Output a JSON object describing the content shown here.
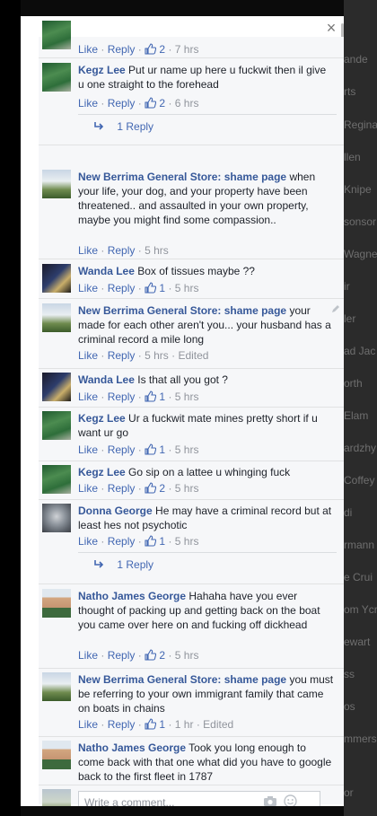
{
  "background": {
    "names": [
      "ande",
      "rts",
      "Regina",
      "llen",
      "Knipe",
      "sonsor",
      "Wagne",
      "ir",
      "ler",
      "ad Jac",
      "orth",
      "Elam",
      "ardzhy",
      "Coffey",
      "di",
      "rmann",
      "e Crui",
      "om Ycr",
      "ewart",
      "ss",
      "os",
      "mmers",
      "or"
    ]
  },
  "modal": {
    "close_label": "×"
  },
  "labels": {
    "like": "Like",
    "reply": "Reply",
    "sep": "·",
    "edited": "Edited"
  },
  "comments": [
    {
      "author": "",
      "text": "",
      "likes": "2",
      "time": "7 hrs"
    },
    {
      "author": "Kegz Lee",
      "text": "Put ur name up here u fuckwit then il give u one straight to the forehead",
      "likes": "2",
      "time": "6 hrs"
    },
    {
      "author": "New Berrima General Store: shame page",
      "text": "when your life, your dog, and your property have been threatened.. and assaulted in your own property, maybe you might find some compassion..",
      "likes": "",
      "time": "5 hrs"
    },
    {
      "author": "Wanda Lee",
      "text": "Box of tissues maybe ??",
      "likes": "1",
      "time": "5 hrs"
    },
    {
      "author": "New Berrima General Store: shame page",
      "text": "your made for each other aren't you... your husband has a criminal record a mile long",
      "likes": "",
      "time": "5 hrs"
    },
    {
      "author": "Wanda Lee",
      "text": "Is that all you got ?",
      "likes": "1",
      "time": "5 hrs"
    },
    {
      "author": "Kegz Lee",
      "text": "Ur a fuckwit mate mines pretty short if u want ur go",
      "likes": "1",
      "time": "5 hrs"
    },
    {
      "author": "Kegz Lee",
      "text": "Go sip on a lattee u whinging fuck",
      "likes": "2",
      "time": "5 hrs"
    },
    {
      "author": "Donna George",
      "text": "He may have a criminal record but at least hes not psychotic",
      "likes": "1",
      "time": "5 hrs"
    },
    {
      "author": "Natho James George",
      "text": "Hahaha have you ever thought of packing up and getting back on the boat you came over here on and fucking off dickhead",
      "likes": "2",
      "time": "5 hrs"
    },
    {
      "author": "New Berrima General Store: shame page",
      "text": "you must be referring to your own immigrant family that came on boats in chains",
      "likes": "1",
      "time": "1 hr"
    },
    {
      "author": "Natho James George",
      "text": "Took you long enough to come back with that one what did you have to google back to the first fleet in 1787",
      "likes": "",
      "time": ""
    }
  ],
  "reply_links": [
    "1 Reply",
    "1 Reply"
  ],
  "composer": {
    "placeholder": "Write a comment...",
    "icons": [
      "camera-icon",
      "smiley-icon"
    ]
  },
  "colors": {
    "author": "#365899",
    "link": "#4267b2",
    "meta": "#90949c"
  }
}
